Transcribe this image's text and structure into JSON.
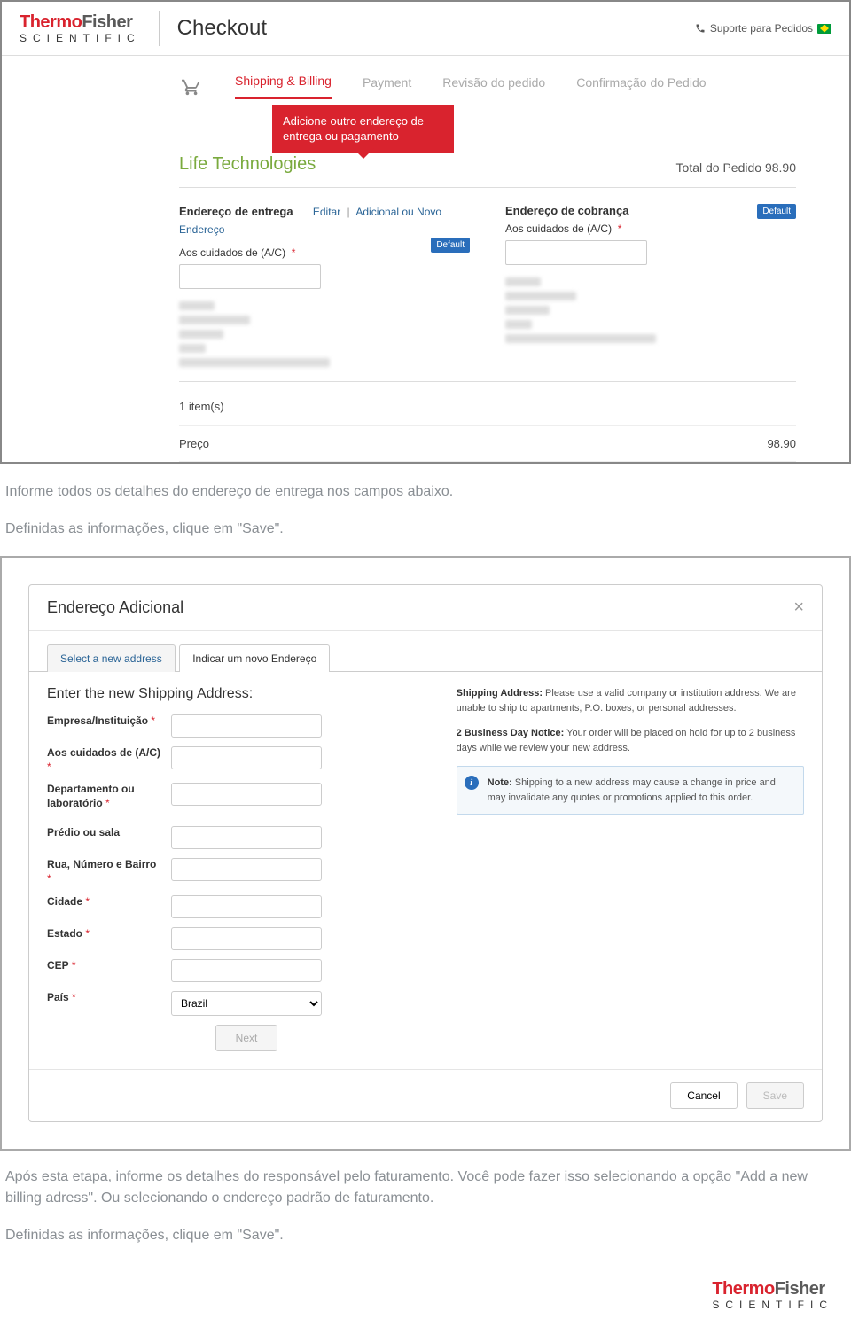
{
  "header": {
    "logo": {
      "part1": "Thermo",
      "part2": "Fisher",
      "sub": "SCIENTIFIC"
    },
    "page_title": "Checkout",
    "support_label": "Suporte para Pedidos"
  },
  "steps": {
    "s1": "Shipping & Billing",
    "s2": "Payment",
    "s3": "Revisão do pedido",
    "s4": "Confirmação do Pedido"
  },
  "callout": "Adicione outro endereço de entrega ou pagamento",
  "brand_section": "Life Technologies",
  "order_total_label": "Total do Pedido 98.90",
  "shipping": {
    "title": "Endereço de entrega",
    "edit": "Editar",
    "addnew": "Adicional ou Novo",
    "endereco": "Endereço",
    "care_label": "Aos cuidados de (A/C)",
    "default": "Default"
  },
  "billing": {
    "title": "Endereço de cobrança",
    "care_label": "Aos cuidados de (A/C)",
    "default": "Default"
  },
  "items": {
    "count_label": "1 item(s)",
    "price_label": "Preço",
    "price_value": "98.90"
  },
  "instruction1a": "Informe todos os detalhes do endereço de entrega nos campos abaixo.",
  "instruction1b": "Definidas as informações, clique em \"Save\".",
  "modal": {
    "title": "Endereço Adicional",
    "tab1": "Select a new address",
    "tab2": "Indicar um novo Endereço",
    "form_title": "Enter the new Shipping Address:",
    "fields": {
      "empresa": "Empresa/Instituição",
      "cuidados": "Aos cuidados de (A/C)",
      "dept": "Departamento ou laboratório",
      "predio": "Prédio ou sala",
      "rua": "Rua, Número e Bairro",
      "cidade": "Cidade",
      "estado": "Estado",
      "cep": "CEP",
      "pais": "País"
    },
    "country_value": "Brazil",
    "next_btn": "Next",
    "info1_bold": "Shipping Address:",
    "info1_text": " Please use a valid company or institution address. We are unable to ship to apartments, P.O. boxes, or personal addresses.",
    "info2_bold": "2 Business Day Notice:",
    "info2_text": " Your order will be placed on hold for up to 2 business days while we review your new address.",
    "note_bold": "Note:",
    "note_text": " Shipping to a new address may cause a change in price and may invalidate any quotes or promotions applied to this order.",
    "cancel": "Cancel",
    "save": "Save"
  },
  "instruction2a": "Após esta etapa, informe os detalhes do responsável pelo faturamento. Você pode fazer isso selecionando a opção  \"Add a new billing adress\". Ou selecionando o endereço padrão de faturamento.",
  "instruction2b": "Definidas as informações, clique em \"Save\"."
}
